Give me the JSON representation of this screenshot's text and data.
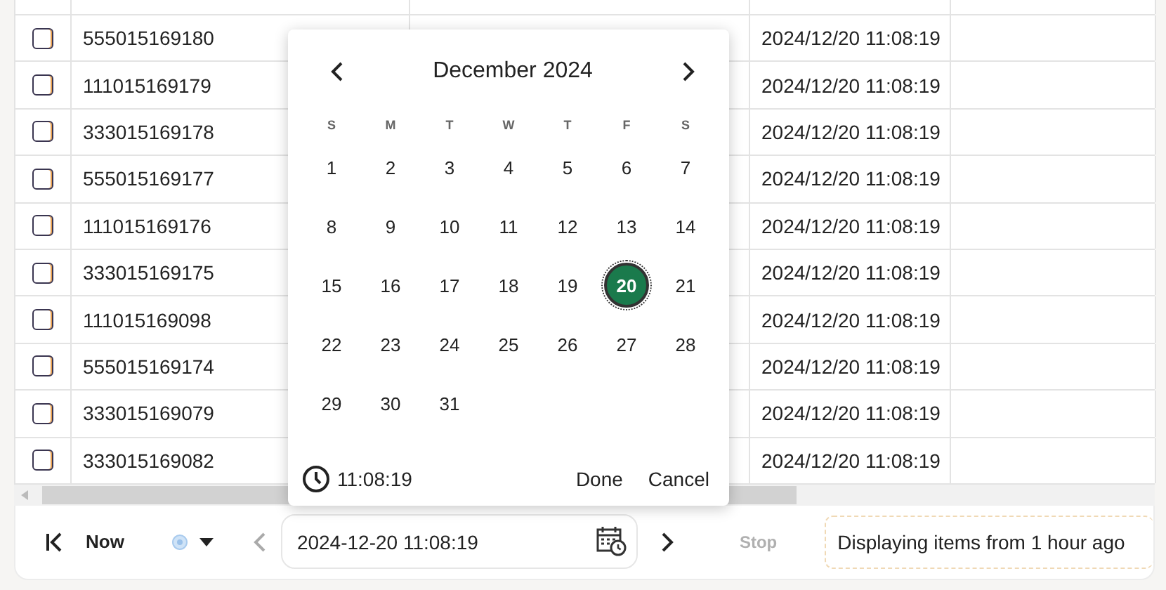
{
  "table": {
    "rows": [
      {
        "checked": false,
        "id": "555015169180",
        "time": "2024/12/20 11:08:19"
      },
      {
        "checked": false,
        "id": "111015169179",
        "time": "2024/12/20 11:08:19"
      },
      {
        "checked": false,
        "id": "333015169178",
        "time": "2024/12/20 11:08:19"
      },
      {
        "checked": false,
        "id": "555015169177",
        "time": "2024/12/20 11:08:19"
      },
      {
        "checked": false,
        "id": "111015169176",
        "time": "2024/12/20 11:08:19"
      },
      {
        "checked": false,
        "id": "333015169175",
        "time": "2024/12/20 11:08:19"
      },
      {
        "checked": false,
        "id": "111015169098",
        "time": "2024/12/20 11:08:19"
      },
      {
        "checked": false,
        "id": "555015169174",
        "time": "2024/12/20 11:08:19"
      },
      {
        "checked": false,
        "id": "333015169079",
        "time": "2024/12/20 11:08:19"
      },
      {
        "checked": false,
        "id": "333015169082",
        "time": "2024/12/20 11:08:19"
      }
    ]
  },
  "calendar": {
    "title": "December 2024",
    "weekdays": [
      "S",
      "M",
      "T",
      "W",
      "T",
      "F",
      "S"
    ],
    "days": [
      {
        "label": "1",
        "selected": false
      },
      {
        "label": "2",
        "selected": false
      },
      {
        "label": "3",
        "selected": false
      },
      {
        "label": "4",
        "selected": false
      },
      {
        "label": "5",
        "selected": false
      },
      {
        "label": "6",
        "selected": false
      },
      {
        "label": "7",
        "selected": false
      },
      {
        "label": "8",
        "selected": false
      },
      {
        "label": "9",
        "selected": false
      },
      {
        "label": "10",
        "selected": false
      },
      {
        "label": "11",
        "selected": false
      },
      {
        "label": "12",
        "selected": false
      },
      {
        "label": "13",
        "selected": false
      },
      {
        "label": "14",
        "selected": false
      },
      {
        "label": "15",
        "selected": false
      },
      {
        "label": "16",
        "selected": false
      },
      {
        "label": "17",
        "selected": false
      },
      {
        "label": "18",
        "selected": false
      },
      {
        "label": "19",
        "selected": false
      },
      {
        "label": "20",
        "selected": true
      },
      {
        "label": "21",
        "selected": false
      },
      {
        "label": "22",
        "selected": false
      },
      {
        "label": "23",
        "selected": false
      },
      {
        "label": "24",
        "selected": false
      },
      {
        "label": "25",
        "selected": false
      },
      {
        "label": "26",
        "selected": false
      },
      {
        "label": "27",
        "selected": false
      },
      {
        "label": "28",
        "selected": false
      },
      {
        "label": "29",
        "selected": false
      },
      {
        "label": "30",
        "selected": false
      },
      {
        "label": "31",
        "selected": false
      }
    ],
    "time": "11:08:19",
    "buttons": [
      "Done",
      "Cancel"
    ]
  },
  "toolbar": {
    "now": "Now",
    "date_value": "2024-12-20 11:08:19",
    "stop": {
      "label": "Stop",
      "disabled": true
    },
    "status": "Displaying items from 1 hour ago"
  }
}
